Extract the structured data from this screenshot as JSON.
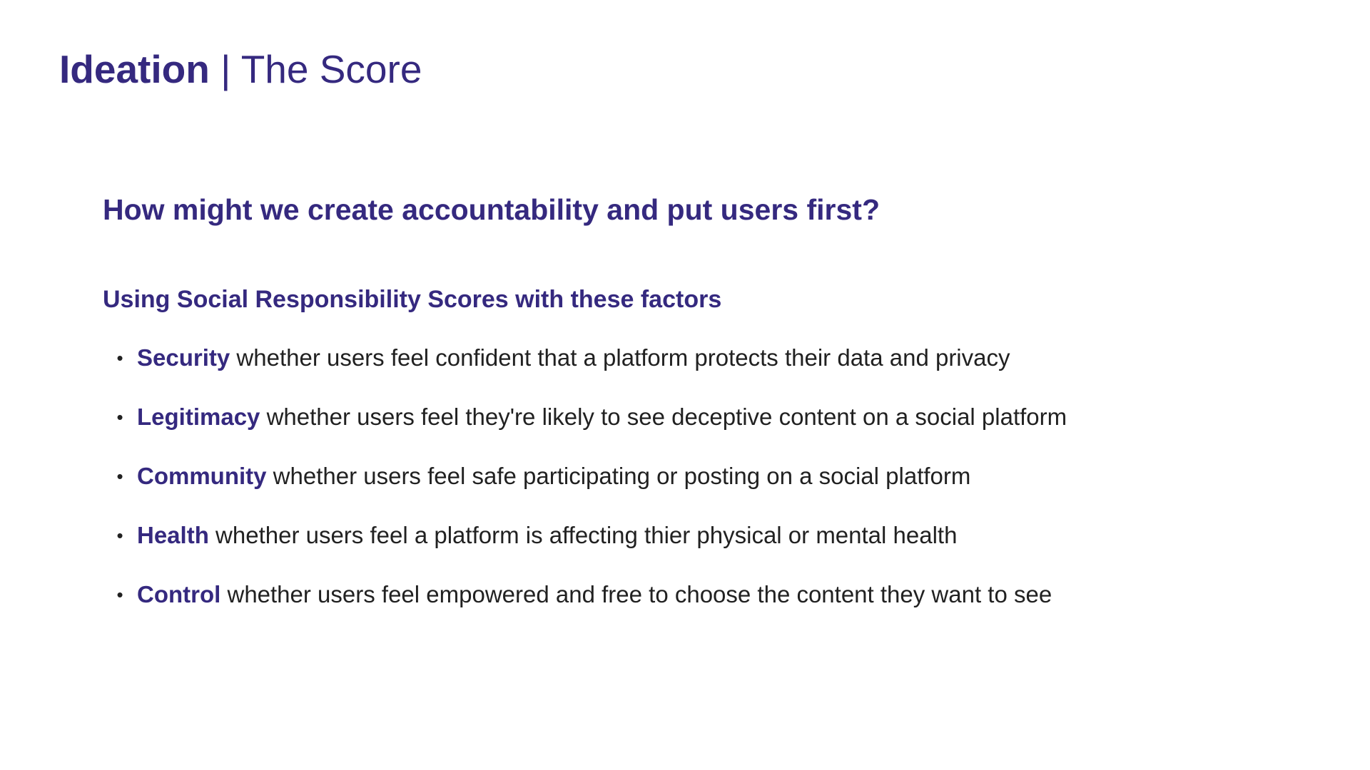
{
  "title": {
    "strong": "Ideation",
    "rest": " | The Score"
  },
  "question": "How might we create accountability and put users first?",
  "subheading": "Using Social Responsibility Scores with these factors",
  "bullet_glyph": "•",
  "factors": [
    {
      "name": "Security",
      "description": " whether users feel confident that a platform protects their data and privacy"
    },
    {
      "name": "Legitimacy",
      "description": " whether users feel they're likely to see deceptive content on a social platform"
    },
    {
      "name": "Community",
      "description": " whether users feel safe participating or posting on a social platform"
    },
    {
      "name": "Health",
      "description": " whether users feel a platform is affecting thier physical or mental health"
    },
    {
      "name": "Control",
      "description": " whether users feel empowered and free to choose the content they want to see"
    }
  ],
  "colors": {
    "accent": "#35297f",
    "body_text": "#212121",
    "background": "#ffffff"
  }
}
